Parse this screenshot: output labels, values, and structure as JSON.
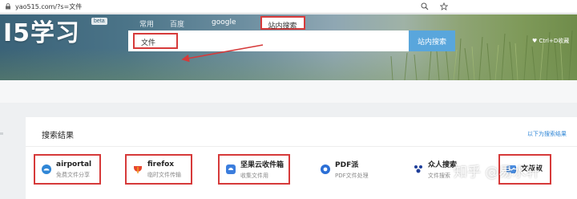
{
  "browser": {
    "url": "yao515.com/?s=文件",
    "icons": [
      "lock-icon",
      "zoom-icon",
      "star-icon"
    ]
  },
  "header": {
    "logo": "I5学习",
    "beta": "beta",
    "tabs": [
      "常用",
      "百度",
      "google",
      "站内搜索"
    ],
    "active_tab": "站内搜索",
    "search_value": "文件",
    "search_button": "站内搜索",
    "hint": "♥ Ctrl+D收藏",
    "highlight_color": "#d63a3a",
    "button_color": "#59a6dc"
  },
  "results": {
    "title": "搜索结果",
    "link": "以下为搜索结果",
    "items": [
      {
        "name": "airportal",
        "desc": "免费文件分享",
        "icon": "airportal-icon"
      },
      {
        "name": "firefox",
        "desc": "临时文件传输",
        "icon": "firefox-icon"
      },
      {
        "name": "坚果云收件箱",
        "desc": "收集文件用",
        "icon": "nutstore-icon"
      },
      {
        "name": "PDF派",
        "desc": "PDF文件处理",
        "icon": "pdf-icon"
      },
      {
        "name": "众人搜索",
        "desc": "文件搜索",
        "icon": "people-icon"
      },
      {
        "name": "文叔叔",
        "desc": "",
        "icon": "wenshushu-icon"
      }
    ]
  },
  "watermark": "知乎 @易水轩"
}
